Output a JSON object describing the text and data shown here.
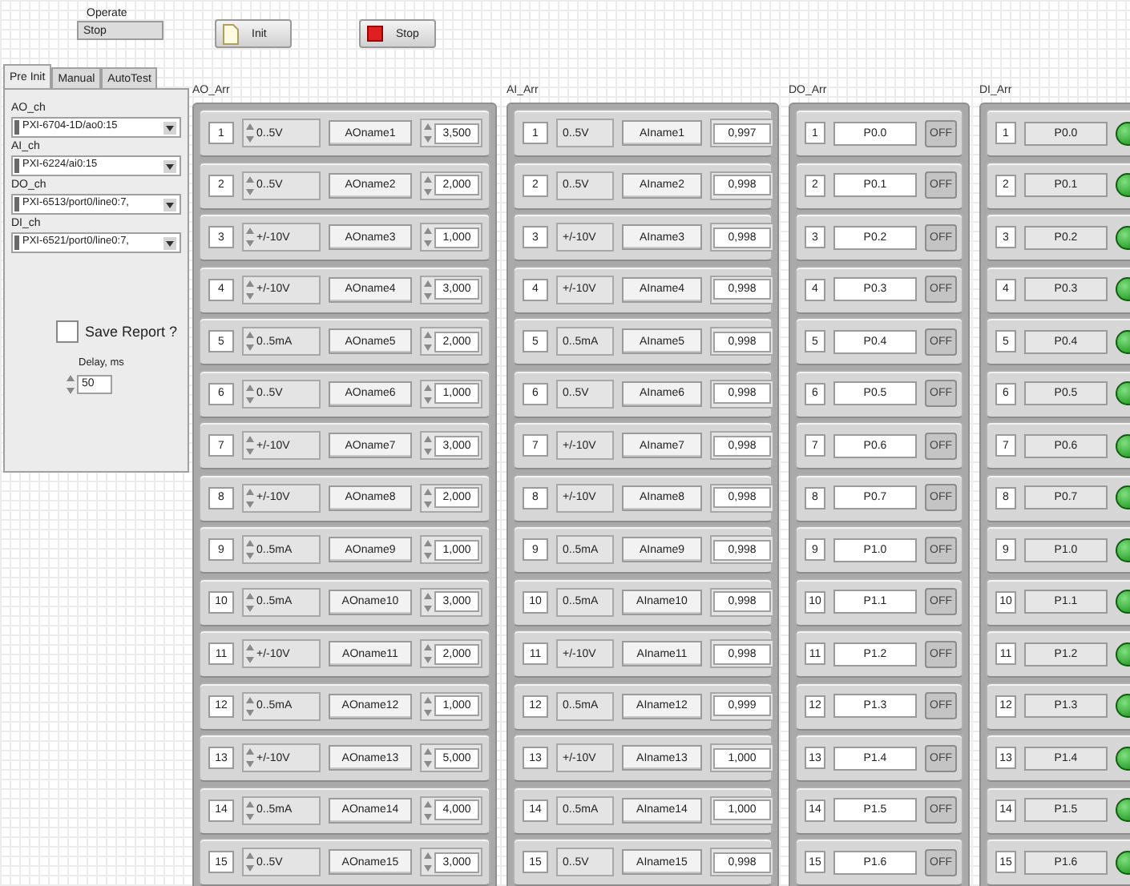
{
  "operate": {
    "label": "Operate",
    "value": "Stop"
  },
  "toolbar": [
    {
      "kind": "init",
      "label": "Init"
    },
    {
      "kind": "stop",
      "label": "Stop"
    }
  ],
  "tabs": [
    {
      "label": "Pre Init",
      "selected": true
    },
    {
      "label": "Manual",
      "selected": false
    },
    {
      "label": "AutoTest",
      "selected": false
    }
  ],
  "pre_init": {
    "fields": [
      {
        "label": "AO_ch",
        "value": "PXI-6704-1D/ao0:15"
      },
      {
        "label": "AI_ch",
        "value": "PXI-6224/ai0:15"
      },
      {
        "label": "DO_ch",
        "value": "PXI-6513/port0/line0:7,"
      },
      {
        "label": "DI_ch",
        "value": "PXI-6521/port0/line0:7,"
      }
    ],
    "save_report": {
      "label": "Save Report ?",
      "checked": false
    },
    "delay": {
      "label": "Delay, ms",
      "value": "50"
    }
  },
  "ao_arr": {
    "label": "AO_Arr",
    "rows": [
      {
        "index": "1",
        "range": "0..5V",
        "name": "AOname1",
        "value": "3,500"
      },
      {
        "index": "2",
        "range": "0..5V",
        "name": "AOname2",
        "value": "2,000"
      },
      {
        "index": "3",
        "range": "+/-10V",
        "name": "AOname3",
        "value": "1,000"
      },
      {
        "index": "4",
        "range": "+/-10V",
        "name": "AOname4",
        "value": "3,000"
      },
      {
        "index": "5",
        "range": "0..5mA",
        "name": "AOname5",
        "value": "2,000"
      },
      {
        "index": "6",
        "range": "0..5V",
        "name": "AOname6",
        "value": "1,000"
      },
      {
        "index": "7",
        "range": "+/-10V",
        "name": "AOname7",
        "value": "3,000"
      },
      {
        "index": "8",
        "range": "+/-10V",
        "name": "AOname8",
        "value": "2,000"
      },
      {
        "index": "9",
        "range": "0..5mA",
        "name": "AOname9",
        "value": "1,000"
      },
      {
        "index": "10",
        "range": "0..5mA",
        "name": "AOname10",
        "value": "3,000"
      },
      {
        "index": "11",
        "range": "+/-10V",
        "name": "AOname11",
        "value": "2,000"
      },
      {
        "index": "12",
        "range": "0..5mA",
        "name": "AOname12",
        "value": "1,000"
      },
      {
        "index": "13",
        "range": "+/-10V",
        "name": "AOname13",
        "value": "5,000"
      },
      {
        "index": "14",
        "range": "0..5mA",
        "name": "AOname14",
        "value": "4,000"
      },
      {
        "index": "15",
        "range": "0..5V",
        "name": "AOname15",
        "value": "3,000"
      }
    ]
  },
  "ai_arr": {
    "label": "AI_Arr",
    "rows": [
      {
        "index": "1",
        "range": "0..5V",
        "name": "AIname1",
        "value": "0,997"
      },
      {
        "index": "2",
        "range": "0..5V",
        "name": "AIname2",
        "value": "0,998"
      },
      {
        "index": "3",
        "range": "+/-10V",
        "name": "AIname3",
        "value": "0,998"
      },
      {
        "index": "4",
        "range": "+/-10V",
        "name": "AIname4",
        "value": "0,998"
      },
      {
        "index": "5",
        "range": "0..5mA",
        "name": "AIname5",
        "value": "0,998"
      },
      {
        "index": "6",
        "range": "0..5V",
        "name": "AIname6",
        "value": "0,998"
      },
      {
        "index": "7",
        "range": "+/-10V",
        "name": "AIname7",
        "value": "0,998"
      },
      {
        "index": "8",
        "range": "+/-10V",
        "name": "AIname8",
        "value": "0,998"
      },
      {
        "index": "9",
        "range": "0..5mA",
        "name": "AIname9",
        "value": "0,998"
      },
      {
        "index": "10",
        "range": "0..5mA",
        "name": "AIname10",
        "value": "0,998"
      },
      {
        "index": "11",
        "range": "+/-10V",
        "name": "AIname11",
        "value": "0,998"
      },
      {
        "index": "12",
        "range": "0..5mA",
        "name": "AIname12",
        "value": "0,999"
      },
      {
        "index": "13",
        "range": "+/-10V",
        "name": "AIname13",
        "value": "1,000"
      },
      {
        "index": "14",
        "range": "0..5mA",
        "name": "AIname14",
        "value": "1,000"
      },
      {
        "index": "15",
        "range": "0..5V",
        "name": "AIname15",
        "value": "0,998"
      }
    ]
  },
  "do_arr": {
    "label": "DO_Arr",
    "rows": [
      {
        "index": "1",
        "line": "P0.0",
        "button": "OFF",
        "on": false
      },
      {
        "index": "2",
        "line": "P0.1",
        "button": "OFF",
        "on": false
      },
      {
        "index": "3",
        "line": "P0.2",
        "button": "OFF",
        "on": false
      },
      {
        "index": "4",
        "line": "P0.3",
        "button": "OFF",
        "on": false
      },
      {
        "index": "5",
        "line": "P0.4",
        "button": "OFF",
        "on": false
      },
      {
        "index": "6",
        "line": "P0.5",
        "button": "OFF",
        "on": false
      },
      {
        "index": "7",
        "line": "P0.6",
        "button": "OFF",
        "on": false
      },
      {
        "index": "8",
        "line": "P0.7",
        "button": "OFF",
        "on": false
      },
      {
        "index": "9",
        "line": "P1.0",
        "button": "OFF",
        "on": false
      },
      {
        "index": "10",
        "line": "P1.1",
        "button": "OFF",
        "on": false
      },
      {
        "index": "11",
        "line": "P1.2",
        "button": "OFF",
        "on": false
      },
      {
        "index": "12",
        "line": "P1.3",
        "button": "OFF",
        "on": false
      },
      {
        "index": "13",
        "line": "P1.4",
        "button": "OFF",
        "on": false
      },
      {
        "index": "14",
        "line": "P1.5",
        "button": "OFF",
        "on": false
      },
      {
        "index": "15",
        "line": "P1.6",
        "button": "OFF",
        "on": false
      }
    ]
  },
  "di_arr": {
    "label": "DI_Arr",
    "rows": [
      {
        "index": "1",
        "line": "P0.0",
        "on": true
      },
      {
        "index": "2",
        "line": "P0.1",
        "on": true
      },
      {
        "index": "3",
        "line": "P0.2",
        "on": true
      },
      {
        "index": "4",
        "line": "P0.3",
        "on": true
      },
      {
        "index": "5",
        "line": "P0.4",
        "on": true
      },
      {
        "index": "6",
        "line": "P0.5",
        "on": true
      },
      {
        "index": "7",
        "line": "P0.6",
        "on": true
      },
      {
        "index": "8",
        "line": "P0.7",
        "on": true
      },
      {
        "index": "9",
        "line": "P1.0",
        "on": true
      },
      {
        "index": "10",
        "line": "P1.1",
        "on": true
      },
      {
        "index": "11",
        "line": "P1.2",
        "on": true
      },
      {
        "index": "12",
        "line": "P1.3",
        "on": true
      },
      {
        "index": "13",
        "line": "P1.4",
        "on": true
      },
      {
        "index": "14",
        "line": "P1.5",
        "on": true
      },
      {
        "index": "15",
        "line": "P1.6",
        "on": true
      }
    ]
  }
}
